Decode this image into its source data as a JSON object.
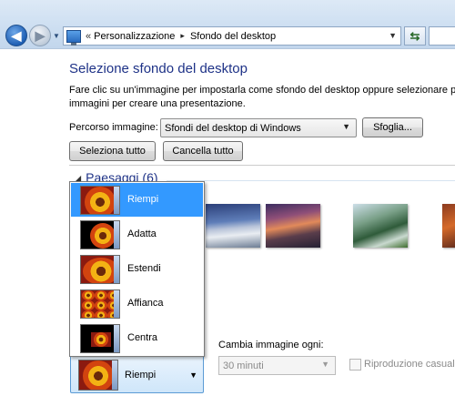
{
  "address_bar": {
    "overflow_chevron": "«",
    "crumbs": [
      "Personalizzazione",
      "Sfondo del desktop"
    ],
    "crumb_separator": "▸"
  },
  "page": {
    "title": "Selezione sfondo del desktop",
    "description": "Fare clic su un'immagine per impostarla come sfondo del desktop oppure selezionare più immagini per creare una presentazione."
  },
  "picture_location": {
    "label": "Percorso immagine:",
    "selected": "Sfondi del desktop di Windows",
    "browse_label": "Sfoglia..."
  },
  "selection_buttons": {
    "select_all": "Seleziona tutto",
    "clear_all": "Cancella tutto"
  },
  "gallery": {
    "group_label": "Paesaggi (6)",
    "thumbnails": [
      "landscape-thumbnail",
      "landscape-thumbnail",
      "landscape-thumbnail",
      "landscape-thumbnail"
    ]
  },
  "picture_position": {
    "selected": "Riempi",
    "options": [
      {
        "label": "Riempi",
        "icon": "fill-icon",
        "selected": true
      },
      {
        "label": "Adatta",
        "icon": "fit-icon",
        "selected": false
      },
      {
        "label": "Estendi",
        "icon": "stretch-icon",
        "selected": false
      },
      {
        "label": "Affianca",
        "icon": "tile-icon",
        "selected": false
      },
      {
        "label": "Centra",
        "icon": "center-icon",
        "selected": false
      }
    ]
  },
  "slideshow": {
    "interval_label": "Cambia immagine ogni:",
    "interval_value": "30 minuti",
    "shuffle_label": "Riproduzione casuale",
    "shuffle_checked": false,
    "disabled": true
  },
  "colors": {
    "title": "#1e3287",
    "selection": "#3399ff",
    "disabled_text": "#8a8a8a"
  }
}
